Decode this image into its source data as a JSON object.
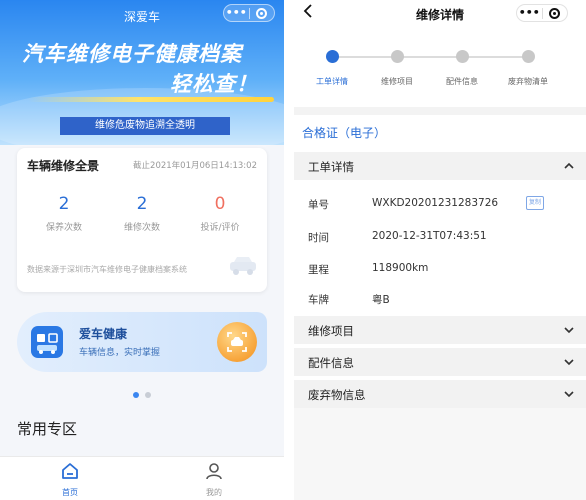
{
  "left_screen": {
    "nav": {
      "title": "深爱车",
      "menu_label": "•••"
    },
    "hero": {
      "headline": "汽车维修电子健康档案",
      "headline2": "轻松查！",
      "banner": "维修危废物追溯全透明"
    },
    "overview_card": {
      "title": "车辆维修全景",
      "deadline": "截止2021年01月06日14:13:02",
      "stats": [
        {
          "value": "2",
          "label": "保养次数"
        },
        {
          "value": "2",
          "label": "维修次数"
        },
        {
          "value": "0",
          "label": "投诉/评价"
        }
      ],
      "source": "数据来源于深圳市汽车维修电子健康档案系统"
    },
    "health_card": {
      "title": "爱车健康",
      "subtitle": "车辆信息，实时掌握"
    },
    "pager": {
      "count": 2,
      "active": 0
    },
    "section_title": "常用专区",
    "tabbar": [
      {
        "label": "首页",
        "icon": "home-icon",
        "active": true
      },
      {
        "label": "我的",
        "icon": "person-icon",
        "active": false
      }
    ]
  },
  "right_screen": {
    "nav": {
      "title": "维修详情",
      "back": "‹",
      "menu_label": "•••"
    },
    "steps": [
      {
        "label": "工单详情",
        "active": true
      },
      {
        "label": "维修项目",
        "active": false
      },
      {
        "label": "配件信息",
        "active": false
      },
      {
        "label": "废弃物清单",
        "active": false
      }
    ],
    "certificate_title": "合格证（电子）",
    "order_section": {
      "title": "工单详情",
      "expanded": true,
      "rows": [
        {
          "key": "单号",
          "value": "WXKD20201231283726"
        },
        {
          "key": "时间",
          "value": "2020-12-31T07:43:51"
        },
        {
          "key": "里程",
          "value": "118900km"
        },
        {
          "key": "车牌",
          "value": "粤B"
        }
      ],
      "copy_tag": "复制"
    },
    "collapsed_sections": [
      {
        "title": "维修项目"
      },
      {
        "title": "配件信息"
      },
      {
        "title": "废弃物信息"
      }
    ]
  },
  "colors": {
    "accent": "#2a6ed6",
    "hero_top": "#2a86f0",
    "banner": "#2f63c9",
    "complaint_red": "#f07060",
    "orange_button": "#f7a43a"
  }
}
